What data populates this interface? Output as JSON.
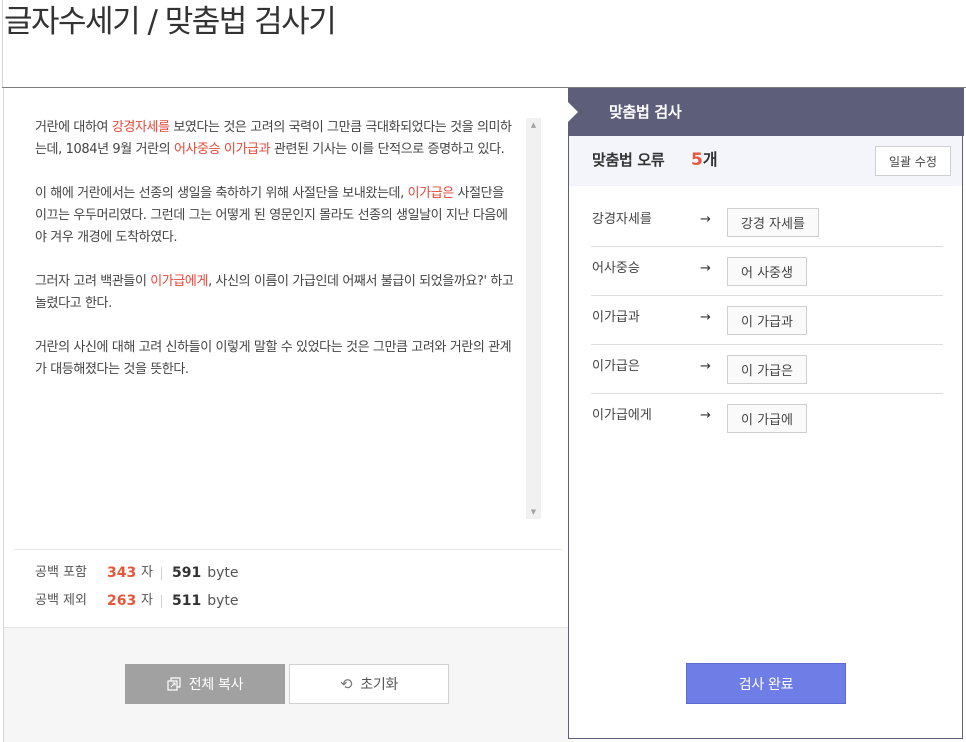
{
  "page": {
    "title": "글자수세기 / 맞춤법 검사기"
  },
  "editor": {
    "paragraphs": [
      [
        {
          "t": "거란에 대하여 ",
          "h": false
        },
        {
          "t": "강경자세를",
          "h": true
        },
        {
          "t": " 보였다는 것은 고려의 국력이 그만큼 극대화되었다는 것을 의미하는데, 1084년 9월 거란의 ",
          "h": false
        },
        {
          "t": "어사중승 이가급과",
          "h": true
        },
        {
          "t": " 관련된 기사는 이를 단적으로 증명하고 있다.",
          "h": false
        }
      ],
      [
        {
          "t": "이 해에 거란에서는 선종의 생일을 축하하기 위해 사절단을 보내왔는데, ",
          "h": false
        },
        {
          "t": "이가급은",
          "h": true
        },
        {
          "t": " 사절단을 이끄는 우두머리였다. 그런데 그는 어떻게 된 영문인지 몰라도 선종의 생일날이 지난 다음에야 겨우 개경에 도착하였다.",
          "h": false
        }
      ],
      [
        {
          "t": "그러자 고려 백관들이 ",
          "h": false
        },
        {
          "t": "이가급에게",
          "h": true
        },
        {
          "t": ", 사신의 이름이 가급인데 어째서 불급이 되었을까요?' 하고 놀렸다고 한다.",
          "h": false
        }
      ],
      [
        {
          "t": "거란의 사신에 대해 고려 신하들이 이렇게 말할 수 있었다는 것은 그만큼 고려와 거란의 관계가 대등해졌다는 것을 뜻한다.",
          "h": false
        }
      ]
    ]
  },
  "stats": {
    "with_space": {
      "label": "공백 포함",
      "chars": "343",
      "char_unit": "자",
      "bytes": "591",
      "byte_unit": "byte"
    },
    "without_space": {
      "label": "공백 제외",
      "chars": "263",
      "char_unit": "자",
      "bytes": "511",
      "byte_unit": "byte"
    }
  },
  "buttons": {
    "copy_all": "전체 복사",
    "reset": "초기화"
  },
  "spellcheck": {
    "title": "맞춤법 검사",
    "error_label": "맞춤법 오류",
    "error_count": "5",
    "error_count_unit": "개",
    "fix_all": "일괄 수정",
    "arrow": "→",
    "corrections": [
      {
        "original": "강경자세를",
        "suggestion": "강경 자세를"
      },
      {
        "original": "어사중승",
        "suggestion": "어 사중생"
      },
      {
        "original": "이가급과",
        "suggestion": "이 가급과"
      },
      {
        "original": "이가급은",
        "suggestion": "이 가급은"
      },
      {
        "original": "이가급에게",
        "suggestion": "이 가급에"
      }
    ],
    "done": "검사 완료"
  },
  "colors": {
    "highlight": "#e8463a",
    "header_bg": "#5d5e7a",
    "primary_button": "#6f7ee6",
    "count_accent": "#e8563a"
  }
}
